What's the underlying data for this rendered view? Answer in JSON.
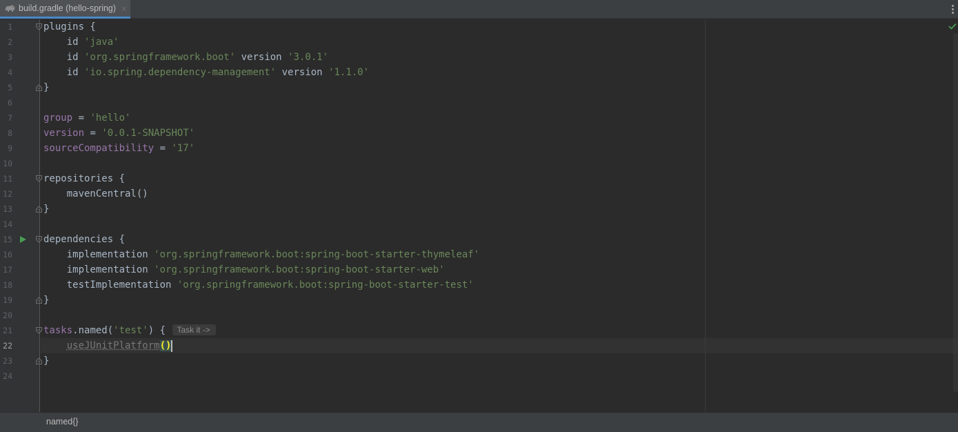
{
  "tab": {
    "label": "build.gradle (hello-spring)",
    "close_glyph": "×",
    "icon": "gradle-elephant-icon"
  },
  "editor": {
    "current_line": 22,
    "status_icon": "check-icon",
    "lines": [
      {
        "n": "1"
      },
      {
        "n": "2"
      },
      {
        "n": "3"
      },
      {
        "n": "4"
      },
      {
        "n": "5"
      },
      {
        "n": "6"
      },
      {
        "n": "7"
      },
      {
        "n": "8"
      },
      {
        "n": "9"
      },
      {
        "n": "10"
      },
      {
        "n": "11"
      },
      {
        "n": "12"
      },
      {
        "n": "13"
      },
      {
        "n": "14"
      },
      {
        "n": "15"
      },
      {
        "n": "16"
      },
      {
        "n": "17"
      },
      {
        "n": "18"
      },
      {
        "n": "19"
      },
      {
        "n": "20"
      },
      {
        "n": "21"
      },
      {
        "n": "22"
      },
      {
        "n": "23"
      },
      {
        "n": "24"
      }
    ],
    "code": {
      "l1": {
        "a": "plugins {"
      },
      "l2": {
        "a": "    id ",
        "b": "'java'"
      },
      "l3": {
        "a": "    id ",
        "b": "'org.springframework.boot'",
        "c": " version ",
        "d": "'3.0.1'"
      },
      "l4": {
        "a": "    id ",
        "b": "'io.spring.dependency-management'",
        "c": " version ",
        "d": "'1.1.0'"
      },
      "l5": {
        "a": "}"
      },
      "l7": {
        "a": "group",
        "b": " = ",
        "c": "'hello'"
      },
      "l8": {
        "a": "version",
        "b": " = ",
        "c": "'0.0.1-SNAPSHOT'"
      },
      "l9": {
        "a": "sourceCompatibility",
        "b": " = ",
        "c": "'17'"
      },
      "l11": {
        "a": "repositories {"
      },
      "l12": {
        "a": "    mavenCentral()"
      },
      "l13": {
        "a": "}"
      },
      "l15": {
        "a": "dependencies {"
      },
      "l16": {
        "a": "    implementation ",
        "b": "'org.springframework.boot:spring-boot-starter-thymeleaf'"
      },
      "l17": {
        "a": "    implementation ",
        "b": "'org.springframework.boot:spring-boot-starter-web'"
      },
      "l18": {
        "a": "    testImplementation ",
        "b": "'org.springframework.boot:spring-boot-starter-test'"
      },
      "l19": {
        "a": "}"
      },
      "l21": {
        "a": "tasks",
        "b": ".named(",
        "c": "'test'",
        "d": ") { ",
        "hint": "Task it ->"
      },
      "l22": {
        "a": "    ",
        "b": "useJUnitPlatform",
        "c": "()"
      },
      "l23": {
        "a": "}"
      }
    }
  },
  "breadcrumb": {
    "item": "named{}"
  },
  "colors": {
    "background": "#2b2b2b",
    "string": "#6a8759",
    "property": "#9876aa",
    "text": "#a9b7c6",
    "run_green": "#499c54",
    "tab_accent": "#4a88c7"
  }
}
